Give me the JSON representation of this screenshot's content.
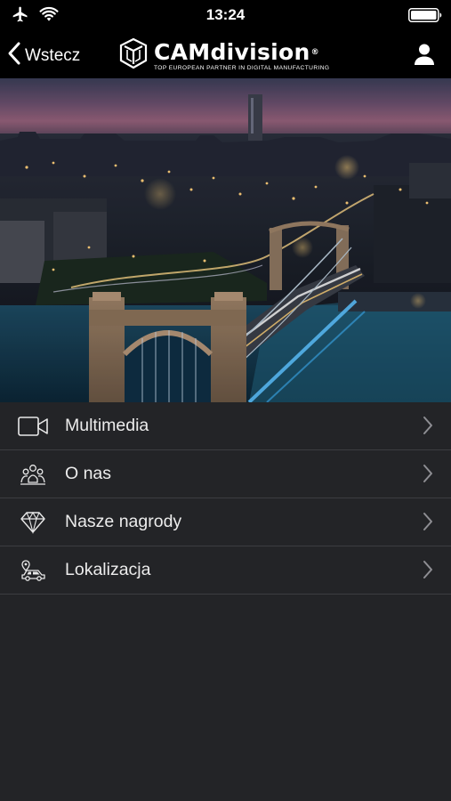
{
  "status_bar": {
    "time": "13:24",
    "icons": [
      "airplane-icon",
      "wifi-icon",
      "battery-icon"
    ]
  },
  "nav": {
    "back_label": "Wstecz",
    "brand_name": "CAMdivision",
    "brand_trademark": "®",
    "brand_tagline": "Top European Partner in Digital Manufacturing",
    "profile_icon": "user-icon"
  },
  "hero": {
    "icon": "city-bridge-night-photo"
  },
  "menu": {
    "items": [
      {
        "label": "Multimedia",
        "icon": "video-camera-icon"
      },
      {
        "label": "O nas",
        "icon": "team-icon"
      },
      {
        "label": "Nasze nagrody",
        "icon": "diamond-icon"
      },
      {
        "label": "Lokalizacja",
        "icon": "location-car-icon"
      }
    ]
  },
  "colors": {
    "background": "#232427",
    "bar": "#000000",
    "text": "#ececec",
    "separator": "#3c3d41",
    "chevron": "#8e8e93"
  }
}
